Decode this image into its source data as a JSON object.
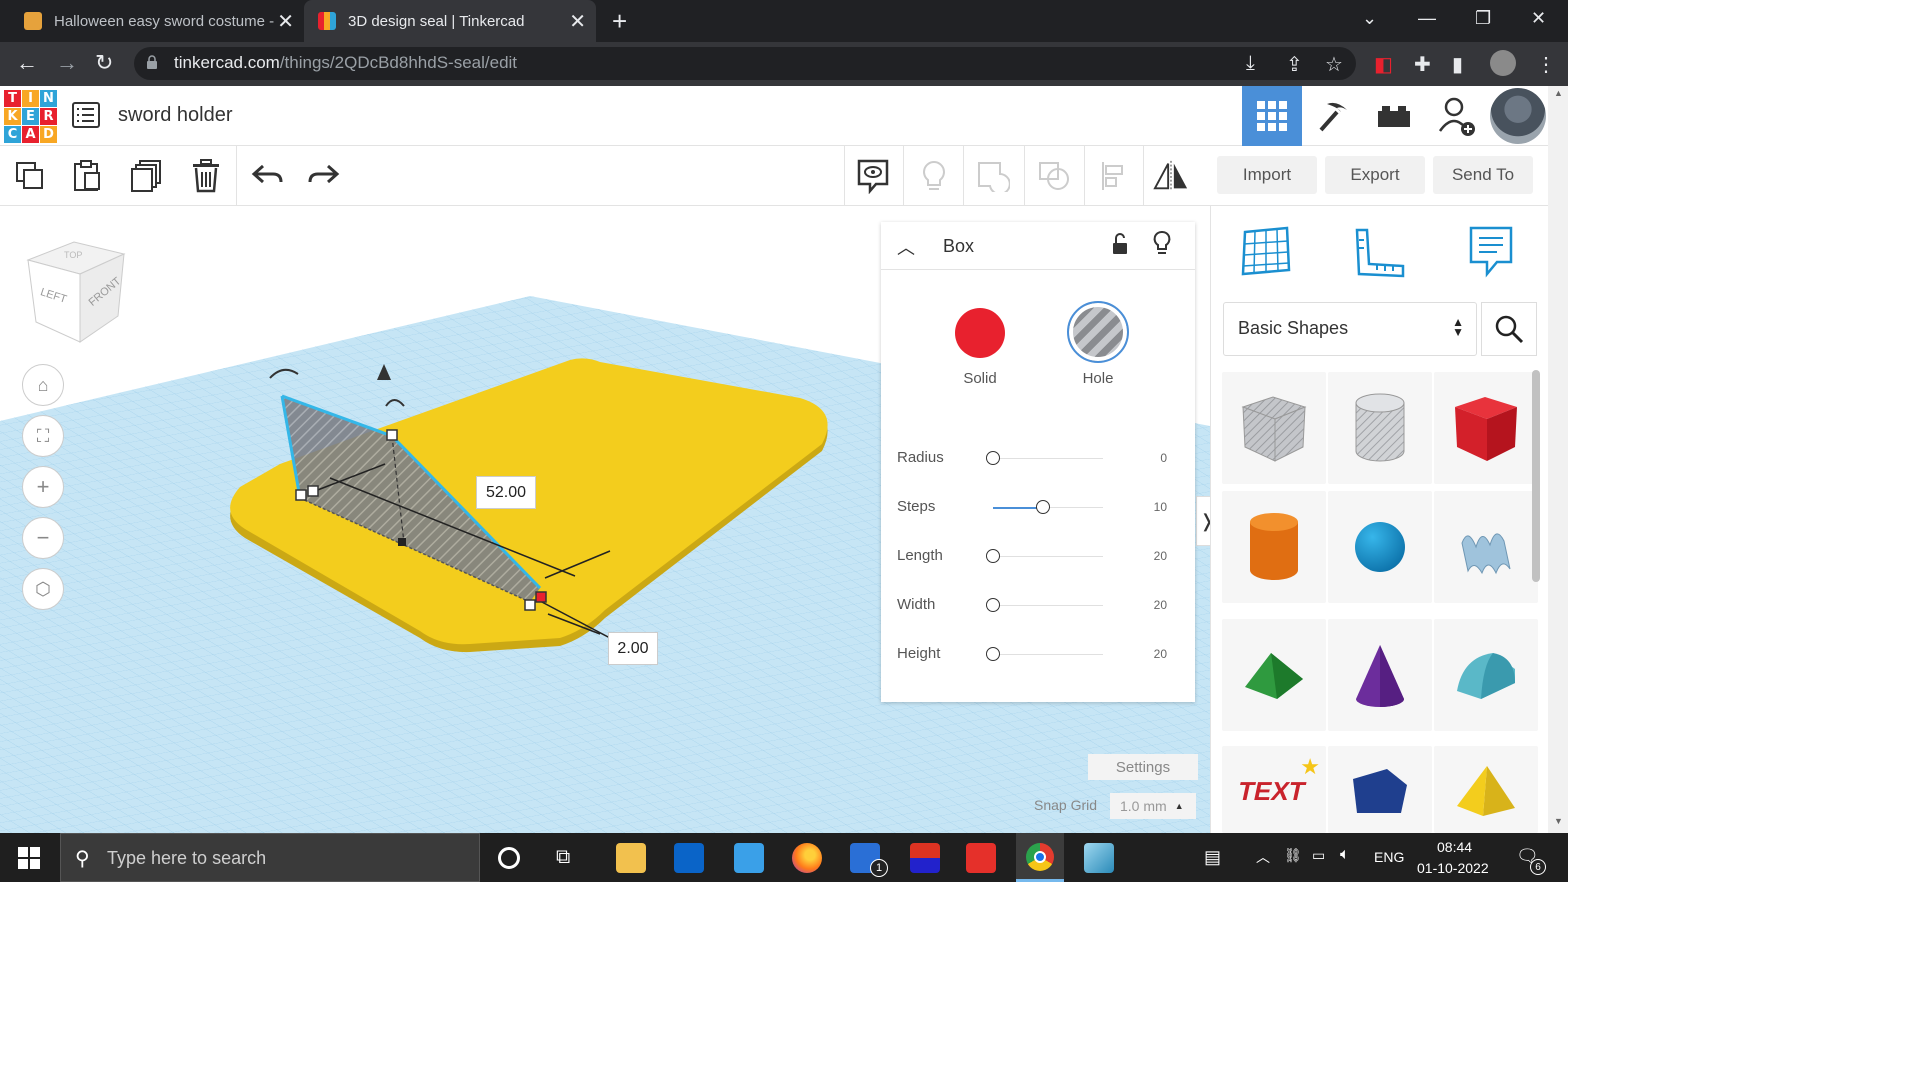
{
  "browser": {
    "tabs": [
      {
        "title": "Halloween easy sword costume -",
        "active": false
      },
      {
        "title": "3D design seal | Tinkercad",
        "active": true
      }
    ],
    "url_host": "tinkercad.com",
    "url_path": "/things/2QDcBd8hhdS-seal/edit"
  },
  "app": {
    "logo_letters": [
      "T",
      "I",
      "N",
      "K",
      "E",
      "R",
      "C",
      "A",
      "D"
    ],
    "design_name": "sword holder"
  },
  "toolbar": {
    "import_label": "Import",
    "export_label": "Export",
    "sendto_label": "Send To"
  },
  "viewcube": {
    "left": "LEFT",
    "front": "FRONT",
    "top": "TOP"
  },
  "workplane": {
    "dimension_length": "52.00",
    "dimension_width": "2.00"
  },
  "inspector": {
    "title": "Box",
    "solid_label": "Solid",
    "hole_label": "Hole",
    "params": [
      {
        "label": "Radius",
        "value": "0",
        "level": 0.0
      },
      {
        "label": "Steps",
        "value": "10",
        "level": 0.45
      },
      {
        "label": "Length",
        "value": "20",
        "level": 0.0
      },
      {
        "label": "Width",
        "value": "20",
        "level": 0.0
      },
      {
        "label": "Height",
        "value": "20",
        "level": 0.0
      }
    ]
  },
  "settings": {
    "settings_label": "Settings",
    "snap_grid_label": "Snap Grid",
    "snap_grid_value": "1.0 mm"
  },
  "library": {
    "category": "Basic Shapes"
  },
  "taskbar": {
    "search_placeholder": "Type here to search",
    "language": "ENG",
    "time": "08:44",
    "date": "01-10-2022",
    "notification_count": "6",
    "todo_badge": "1"
  },
  "colors": {
    "accent": "#4a8fd8",
    "solid_red": "#e8212e",
    "workplane_blue": "#bfe0f2",
    "shape_yellow": "#f3cd1d"
  }
}
